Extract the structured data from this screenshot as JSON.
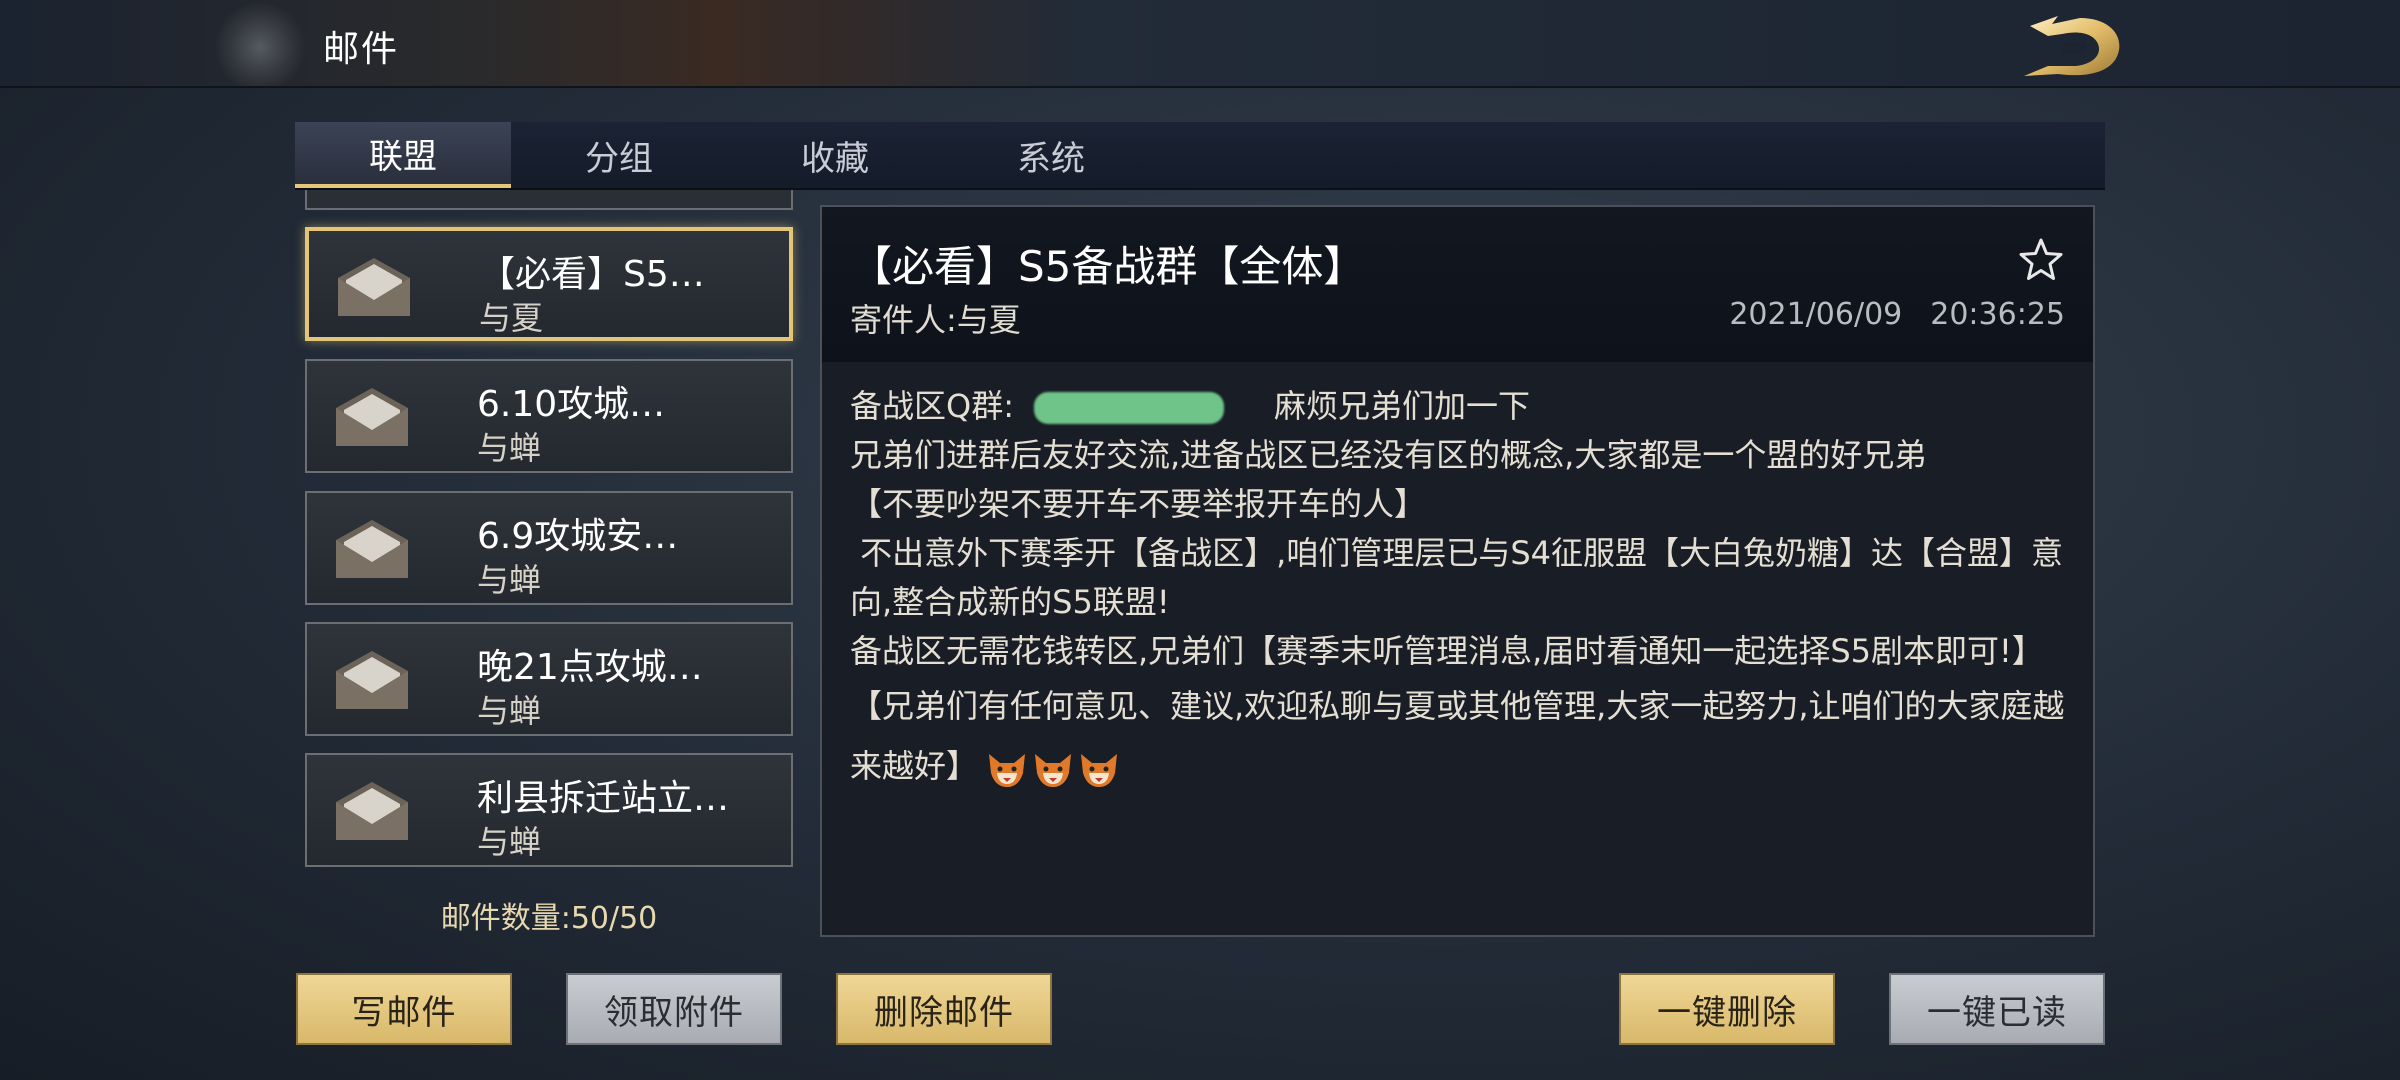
{
  "header": {
    "title": "邮件",
    "logo_icon": "dragon-logo-icon"
  },
  "tabs": [
    {
      "label": "联盟",
      "active": true
    },
    {
      "label": "分组",
      "active": false
    },
    {
      "label": "收藏",
      "active": false
    },
    {
      "label": "系统",
      "active": false
    }
  ],
  "mail_list": [
    {
      "subject": "【必看】S5…",
      "sender": "与夏",
      "selected": true
    },
    {
      "subject": "6.10攻城…",
      "sender": "与蝉",
      "selected": false
    },
    {
      "subject": "6.9攻城安…",
      "sender": "与蝉",
      "selected": false
    },
    {
      "subject": "晚21点攻城…",
      "sender": "与蝉",
      "selected": false
    },
    {
      "subject": "利县拆迁站立…",
      "sender": "与蝉",
      "selected": false
    }
  ],
  "mail_count": {
    "label": "邮件数量:",
    "value": "50/50"
  },
  "detail": {
    "title": "【必看】S5备战群【全体】",
    "sender_label": "寄件人:",
    "sender": "与夏",
    "date": "2021/06/09",
    "time": "20:36:25",
    "body": {
      "line1_prefix": "备战区Q群:",
      "line1_suffix": "麻烦兄弟们加一下",
      "line2": "兄弟们进群后友好交流,进备战区已经没有区的概念,大家都是一个盟的好兄弟",
      "line3": "【不要吵架不要开车不要举报开车的人】",
      "line4": " 不出意外下赛季开【备战区】,咱们管理层已与S4征服盟【大白兔奶糖】达【合盟】意向,整合成新的S5联盟!",
      "line5": "备战区无需花钱转区,兄弟们【赛季末听管理消息,届时看通知一起选择S5剧本即可!】",
      "line6": "【兄弟们有任何意见、建议,欢迎私聊与夏或其他管理,大家一起努力,让咱们的大家庭越来越好】"
    }
  },
  "buttons": {
    "write": "写邮件",
    "claim": "领取附件",
    "delete": "删除邮件",
    "delete_all": "一键删除",
    "read_all": "一键已读"
  },
  "colors": {
    "accent_gold": "#e3c57a",
    "redaction": "#6fc48a"
  }
}
